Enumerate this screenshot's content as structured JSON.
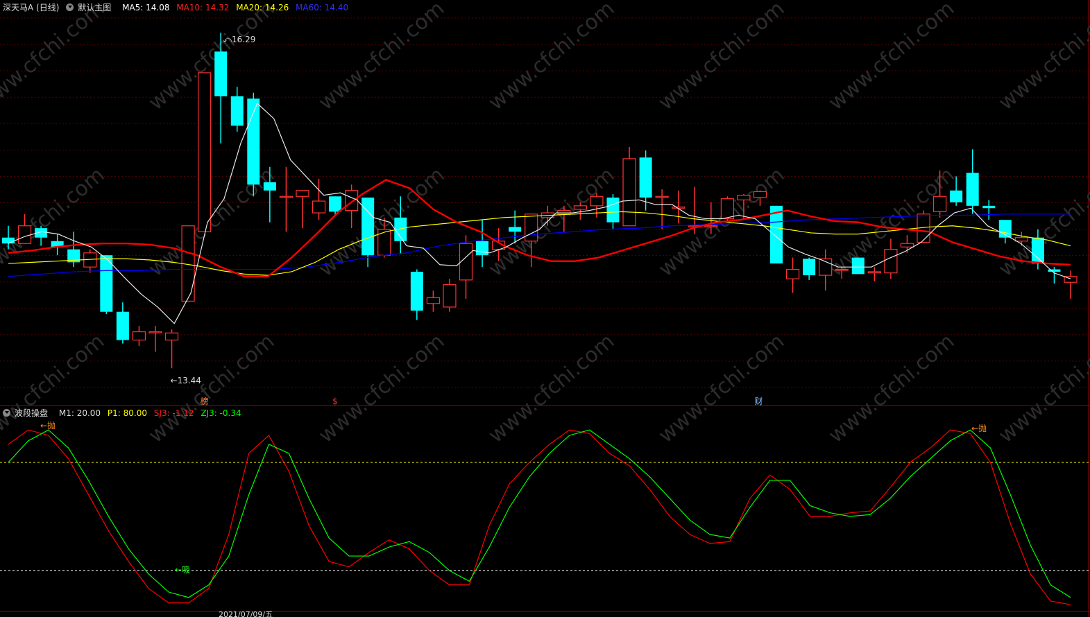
{
  "header": {
    "stock_name": "深天马A (日线)",
    "template": "默认主图",
    "ma5": "MA5: 14.08",
    "ma10": "MA10: 14.32",
    "ma20": "MA20: 14.26",
    "ma60": "MA60: 14.40"
  },
  "colors": {
    "up": "#ff3232",
    "down": "#00ffff",
    "ma5": "#ffffff",
    "ma10": "#ff0000",
    "ma20": "#ffff00",
    "ma60": "#0000ff",
    "k_line": "#ff0000",
    "d_line": "#00ff00",
    "grid": "#5a0000",
    "upper_band": "#ffff00",
    "lower_band": "#ffffff"
  },
  "annotations": {
    "high_label": "16.29",
    "low_label": "13.44",
    "markers": [
      "榜",
      "$",
      "财"
    ],
    "sell_signal": "抛",
    "buy_signal": "吸"
  },
  "indicator_header": {
    "name": "波段操盘",
    "m1": "M1: 20.00",
    "p1": "P1: 80.00",
    "sj3": "SJ3: -1.12",
    "zj3": "ZJ3: -0.34"
  },
  "watermark": "www.cfchi.com",
  "date_label": "2021/07/09/五",
  "chart_data": {
    "type": "candlestick",
    "title": "深天马A (日线)",
    "ylim": [
      13.2,
      16.45
    ],
    "candles": [
      {
        "o": 14.55,
        "h": 14.65,
        "l": 14.45,
        "c": 14.5
      },
      {
        "o": 14.5,
        "h": 14.75,
        "l": 14.5,
        "c": 14.65
      },
      {
        "o": 14.63,
        "h": 14.65,
        "l": 14.48,
        "c": 14.55
      },
      {
        "o": 14.52,
        "h": 14.58,
        "l": 14.4,
        "c": 14.47
      },
      {
        "o": 14.45,
        "h": 14.6,
        "l": 14.3,
        "c": 14.34
      },
      {
        "o": 14.3,
        "h": 14.45,
        "l": 14.25,
        "c": 14.42
      },
      {
        "o": 14.4,
        "h": 14.4,
        "l": 13.9,
        "c": 13.92
      },
      {
        "o": 13.92,
        "h": 14.0,
        "l": 13.65,
        "c": 13.68
      },
      {
        "o": 13.68,
        "h": 13.8,
        "l": 13.63,
        "c": 13.75
      },
      {
        "o": 13.75,
        "h": 13.8,
        "l": 13.58,
        "c": 13.75
      },
      {
        "o": 13.68,
        "h": 13.77,
        "l": 13.44,
        "c": 13.74
      },
      {
        "o": 14.01,
        "h": 14.65,
        "l": 14.01,
        "c": 14.65
      },
      {
        "o": 14.6,
        "h": 15.95,
        "l": 14.6,
        "c": 15.95
      },
      {
        "o": 16.13,
        "h": 16.29,
        "l": 15.35,
        "c": 15.75
      },
      {
        "o": 15.75,
        "h": 15.83,
        "l": 15.45,
        "c": 15.5
      },
      {
        "o": 15.73,
        "h": 15.78,
        "l": 14.9,
        "c": 15.0
      },
      {
        "o": 15.02,
        "h": 15.15,
        "l": 14.68,
        "c": 14.95
      },
      {
        "o": 14.9,
        "h": 15.15,
        "l": 14.6,
        "c": 14.9
      },
      {
        "o": 14.9,
        "h": 14.95,
        "l": 14.63,
        "c": 14.95
      },
      {
        "o": 14.76,
        "h": 15.05,
        "l": 14.7,
        "c": 14.86
      },
      {
        "o": 14.9,
        "h": 14.9,
        "l": 14.74,
        "c": 14.77
      },
      {
        "o": 14.78,
        "h": 15.0,
        "l": 14.63,
        "c": 14.95
      },
      {
        "o": 14.89,
        "h": 14.89,
        "l": 14.3,
        "c": 14.4
      },
      {
        "o": 14.4,
        "h": 14.72,
        "l": 14.38,
        "c": 14.62
      },
      {
        "o": 14.72,
        "h": 14.9,
        "l": 14.41,
        "c": 14.52
      },
      {
        "o": 14.26,
        "h": 14.28,
        "l": 13.85,
        "c": 13.93
      },
      {
        "o": 13.99,
        "h": 14.1,
        "l": 13.92,
        "c": 14.04
      },
      {
        "o": 13.96,
        "h": 14.2,
        "l": 13.92,
        "c": 14.15
      },
      {
        "o": 14.19,
        "h": 14.57,
        "l": 14.03,
        "c": 14.5
      },
      {
        "o": 14.52,
        "h": 14.7,
        "l": 14.3,
        "c": 14.4
      },
      {
        "o": 14.45,
        "h": 14.63,
        "l": 14.35,
        "c": 14.52
      },
      {
        "o": 14.64,
        "h": 14.78,
        "l": 14.5,
        "c": 14.6
      },
      {
        "o": 14.52,
        "h": 14.75,
        "l": 14.3,
        "c": 14.75
      },
      {
        "o": 14.72,
        "h": 14.82,
        "l": 14.65,
        "c": 14.76
      },
      {
        "o": 14.75,
        "h": 14.82,
        "l": 14.6,
        "c": 14.78
      },
      {
        "o": 14.79,
        "h": 14.85,
        "l": 14.7,
        "c": 14.82
      },
      {
        "o": 14.82,
        "h": 14.93,
        "l": 14.72,
        "c": 14.9
      },
      {
        "o": 14.89,
        "h": 14.92,
        "l": 14.62,
        "c": 14.68
      },
      {
        "o": 14.65,
        "h": 15.32,
        "l": 14.65,
        "c": 15.22
      },
      {
        "o": 15.23,
        "h": 15.29,
        "l": 14.78,
        "c": 14.89
      },
      {
        "o": 14.9,
        "h": 14.96,
        "l": 14.62,
        "c": 14.9
      },
      {
        "o": 14.8,
        "h": 14.95,
        "l": 14.67,
        "c": 14.81
      },
      {
        "o": 14.65,
        "h": 14.98,
        "l": 14.58,
        "c": 14.65
      },
      {
        "o": 14.65,
        "h": 14.85,
        "l": 14.58,
        "c": 14.65
      },
      {
        "o": 14.71,
        "h": 14.9,
        "l": 14.68,
        "c": 14.88
      },
      {
        "o": 14.87,
        "h": 14.92,
        "l": 14.7,
        "c": 14.91
      },
      {
        "o": 14.89,
        "h": 14.95,
        "l": 14.82,
        "c": 14.94
      },
      {
        "o": 14.82,
        "h": 14.82,
        "l": 14.33,
        "c": 14.33
      },
      {
        "o": 14.2,
        "h": 14.38,
        "l": 14.08,
        "c": 14.28
      },
      {
        "o": 14.37,
        "h": 14.38,
        "l": 14.19,
        "c": 14.23
      },
      {
        "o": 14.23,
        "h": 14.45,
        "l": 14.1,
        "c": 14.37
      },
      {
        "o": 14.28,
        "h": 14.3,
        "l": 14.2,
        "c": 14.28
      },
      {
        "o": 14.38,
        "h": 14.38,
        "l": 14.24,
        "c": 14.24
      },
      {
        "o": 14.25,
        "h": 14.3,
        "l": 14.18,
        "c": 14.26
      },
      {
        "o": 14.25,
        "h": 14.54,
        "l": 14.2,
        "c": 14.45
      },
      {
        "o": 14.47,
        "h": 14.57,
        "l": 14.42,
        "c": 14.5
      },
      {
        "o": 14.51,
        "h": 14.78,
        "l": 14.51,
        "c": 14.75
      },
      {
        "o": 14.77,
        "h": 15.12,
        "l": 14.72,
        "c": 14.9
      },
      {
        "o": 14.95,
        "h": 15.07,
        "l": 14.82,
        "c": 14.85
      },
      {
        "o": 15.1,
        "h": 15.3,
        "l": 14.75,
        "c": 14.82
      },
      {
        "o": 14.82,
        "h": 14.87,
        "l": 14.7,
        "c": 14.8
      },
      {
        "o": 14.7,
        "h": 14.7,
        "l": 14.5,
        "c": 14.55
      },
      {
        "o": 14.52,
        "h": 14.6,
        "l": 14.48,
        "c": 14.55
      },
      {
        "o": 14.55,
        "h": 14.62,
        "l": 14.28,
        "c": 14.33
      },
      {
        "o": 14.28,
        "h": 14.3,
        "l": 14.16,
        "c": 14.26
      },
      {
        "o": 14.17,
        "h": 14.27,
        "l": 14.03,
        "c": 14.22
      }
    ],
    "ma5": [
      14.5,
      14.56,
      14.6,
      14.58,
      14.52,
      14.47,
      14.36,
      14.21,
      14.07,
      13.96,
      13.82,
      14.08,
      14.68,
      14.88,
      15.35,
      15.69,
      15.56,
      15.21,
      15.06,
      14.91,
      14.93,
      14.87,
      14.72,
      14.68,
      14.48,
      14.46,
      14.32,
      14.31,
      14.44,
      14.42,
      14.47,
      14.55,
      14.62,
      14.76,
      14.76,
      14.78,
      14.81,
      14.86,
      14.87,
      14.83,
      14.83,
      14.74,
      14.71,
      14.71,
      14.74,
      14.71,
      14.59,
      14.47,
      14.41,
      14.36,
      14.3,
      14.3,
      14.3,
      14.37,
      14.43,
      14.51,
      14.65,
      14.76,
      14.8,
      14.65,
      14.58,
      14.5,
      14.38,
      14.25,
      14.2
    ],
    "ma10": [
      14.42,
      14.44,
      14.47,
      14.49,
      14.5,
      14.5,
      14.49,
      14.46,
      14.4,
      14.3,
      14.22,
      14.22,
      14.38,
      14.57,
      14.77,
      14.92,
      15.04,
      14.97,
      14.79,
      14.68,
      14.6,
      14.48,
      14.4,
      14.35,
      14.35,
      14.38,
      14.44,
      14.5,
      14.56,
      14.63,
      14.68,
      14.7,
      14.74,
      14.78,
      14.73,
      14.69,
      14.68,
      14.64,
      14.62,
      14.6,
      14.51,
      14.45,
      14.39,
      14.35,
      14.33,
      14.32
    ],
    "ma20": [
      14.33,
      14.34,
      14.35,
      14.36,
      14.37,
      14.37,
      14.36,
      14.34,
      14.31,
      14.27,
      14.24,
      14.23,
      14.26,
      14.34,
      14.45,
      14.53,
      14.6,
      14.64,
      14.66,
      14.68,
      14.7,
      14.72,
      14.73,
      14.74,
      14.75,
      14.76,
      14.77,
      14.76,
      14.74,
      14.71,
      14.69,
      14.67,
      14.65,
      14.62,
      14.59,
      14.58,
      14.58,
      14.6,
      14.62,
      14.64,
      14.65,
      14.63,
      14.6,
      14.56,
      14.53,
      14.48
    ],
    "ma60": [
      14.22,
      14.24,
      14.26,
      14.27,
      14.27,
      14.28,
      14.28,
      14.28,
      14.28,
      14.3,
      14.34,
      14.39,
      14.42,
      14.48,
      14.52,
      14.55,
      14.58,
      14.6,
      14.62,
      14.63,
      14.65,
      14.66,
      14.67,
      14.68,
      14.7,
      14.71,
      14.72,
      14.73,
      14.74,
      14.74,
      14.75,
      14.75,
      14.75
    ],
    "indicator": {
      "name": "波段操盘",
      "ylim": [
        -2,
        105
      ],
      "upper_line": 80,
      "lower_line": 20,
      "k": [
        90,
        98,
        95,
        82,
        62,
        42,
        25,
        10,
        2,
        2,
        10,
        40,
        85,
        95,
        75,
        45,
        25,
        22,
        30,
        37,
        32,
        20,
        12,
        12,
        45,
        68,
        80,
        90,
        98,
        96,
        85,
        78,
        65,
        50,
        40,
        35,
        36,
        60,
        73,
        65,
        50,
        50,
        52,
        53,
        66,
        80,
        88,
        98,
        96,
        80,
        46,
        18,
        3,
        1
      ],
      "d": [
        80,
        92,
        98,
        88,
        70,
        50,
        32,
        18,
        8,
        5,
        12,
        28,
        62,
        90,
        85,
        60,
        38,
        28,
        28,
        33,
        36,
        30,
        20,
        14,
        33,
        55,
        72,
        85,
        95,
        98,
        90,
        82,
        72,
        60,
        48,
        40,
        38,
        55,
        70,
        70,
        56,
        52,
        50,
        51,
        60,
        72,
        82,
        92,
        98,
        88,
        62,
        34,
        12,
        5
      ]
    }
  }
}
